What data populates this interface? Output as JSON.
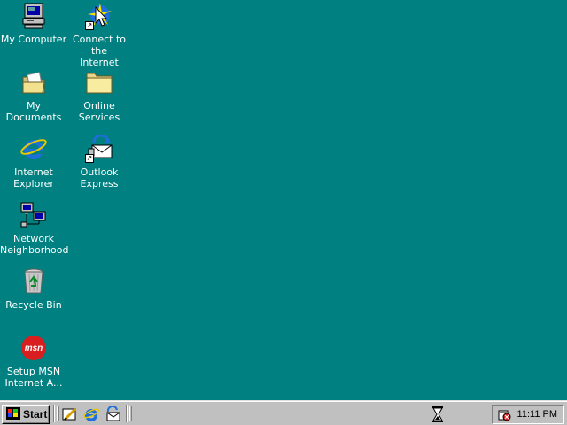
{
  "desktop": {
    "icons": [
      {
        "label": "My Computer",
        "icon": "computer-icon"
      },
      {
        "label": "Connect to the\nInternet",
        "icon": "connect-internet-icon"
      },
      {
        "label": "My Documents",
        "icon": "folder-documents-icon"
      },
      {
        "label": "Online\nServices",
        "icon": "folder-icon"
      },
      {
        "label": "Internet\nExplorer",
        "icon": "internet-explorer-icon"
      },
      {
        "label": "Outlook\nExpress",
        "icon": "outlook-express-icon"
      },
      {
        "label": "Network\nNeighborhood",
        "icon": "network-icon"
      },
      {
        "label": "Recycle Bin",
        "icon": "recycle-bin-icon"
      },
      {
        "label": "Setup MSN\nInternet A...",
        "icon": "msn-icon"
      }
    ],
    "background_color": "#008080"
  },
  "taskbar": {
    "start_label": "Start",
    "quick_launch": [
      "show-desktop-icon",
      "internet-explorer-icon",
      "outlook-express-icon"
    ],
    "busy_indicator": "hourglass-icon",
    "tray": {
      "clock": "11:11 PM",
      "icon": "volume-icon"
    }
  }
}
